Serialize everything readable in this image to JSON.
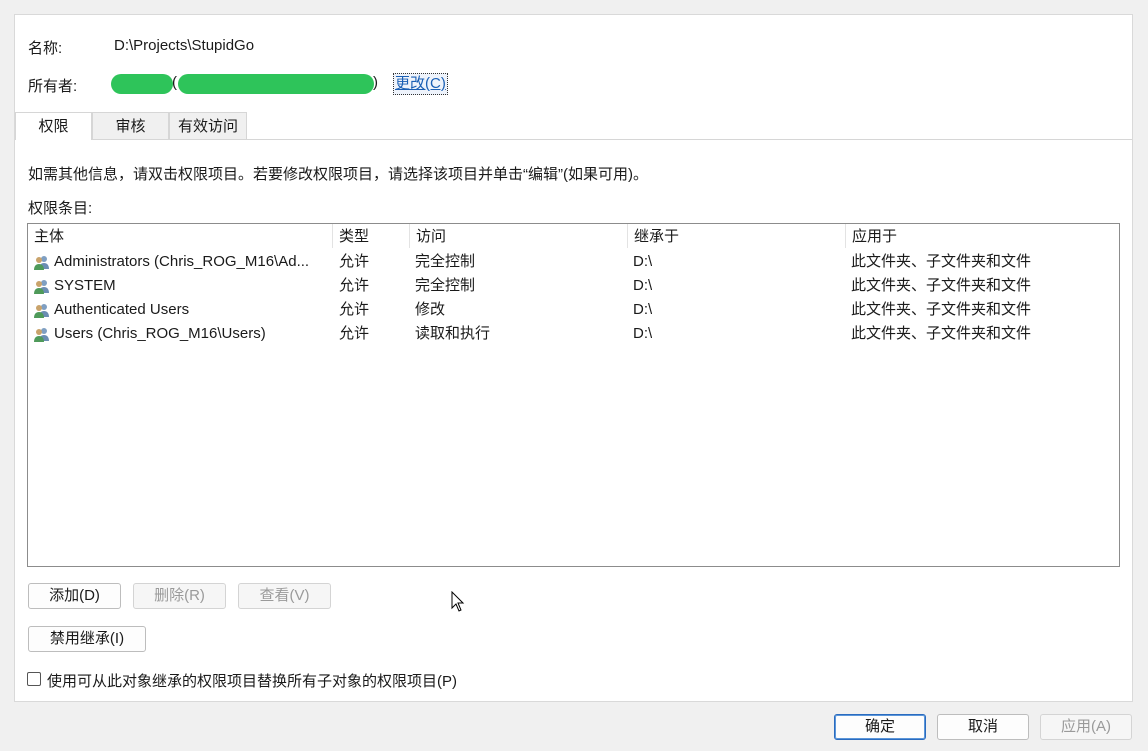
{
  "object": {
    "name_label": "名称:",
    "name_value": "D:\\Projects\\StupidGo",
    "owner_label": "所有者:",
    "owner_paren_open": "(",
    "owner_paren_close": ")",
    "change_link": "更改(C)"
  },
  "tabs": [
    {
      "label": "权限",
      "active": true
    },
    {
      "label": "审核",
      "active": false
    },
    {
      "label": "有效访问",
      "active": false
    }
  ],
  "info_text": "如需其他信息，请双击权限项目。若要修改权限项目，请选择该项目并单击“编辑”(如果可用)。",
  "entries_label": "权限条目:",
  "table": {
    "columns": [
      "主体",
      "类型",
      "访问",
      "继承于",
      "应用于"
    ],
    "rows": [
      {
        "principal": "Administrators (Chris_ROG_M16\\Ad...",
        "type": "允许",
        "access": "完全控制",
        "inherited": "D:\\",
        "applies": "此文件夹、子文件夹和文件"
      },
      {
        "principal": "SYSTEM",
        "type": "允许",
        "access": "完全控制",
        "inherited": "D:\\",
        "applies": "此文件夹、子文件夹和文件"
      },
      {
        "principal": "Authenticated Users",
        "type": "允许",
        "access": "修改",
        "inherited": "D:\\",
        "applies": "此文件夹、子文件夹和文件"
      },
      {
        "principal": "Users (Chris_ROG_M16\\Users)",
        "type": "允许",
        "access": "读取和执行",
        "inherited": "D:\\",
        "applies": "此文件夹、子文件夹和文件"
      }
    ]
  },
  "buttons": {
    "add": "添加(D)",
    "remove": "删除(R)",
    "view": "查看(V)",
    "disable_inheritance": "禁用继承(I)"
  },
  "checkbox_label": "使用可从此对象继承的权限项目替换所有子对象的权限项目(P)",
  "footer": {
    "ok": "确定",
    "cancel": "取消",
    "apply": "应用(A)"
  },
  "colors": {
    "redaction": "#2ec45a",
    "link": "#1a5fb4",
    "primary_border": "#2a6bbf"
  },
  "icons": {
    "principal": "users-icon",
    "cursor": "mouse-pointer-icon"
  }
}
